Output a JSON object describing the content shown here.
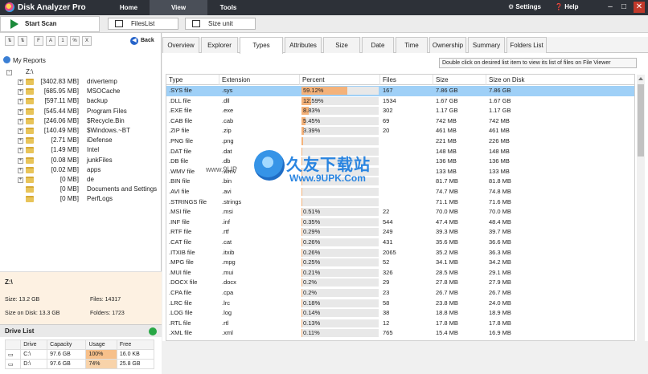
{
  "app": {
    "title": "Disk Analyzer Pro",
    "tabs": [
      "Home",
      "View",
      "Tools"
    ],
    "active_tab": "View",
    "settings": "Settings",
    "help": "Help"
  },
  "toolbar": {
    "start_scan": "Start Scan",
    "fileslist": "FilesList",
    "size_unit": "Size unit"
  },
  "left": {
    "sort_buttons": [
      "⇅",
      "⇅",
      "F",
      "A",
      "1",
      "%",
      "X"
    ],
    "back": "Back",
    "my_reports": "My Reports",
    "root": "Z:\\",
    "tree": [
      {
        "size": "[3402.83 MB]",
        "name": "drivertemp",
        "expand": "+"
      },
      {
        "size": "[685.95 MB]",
        "name": "MSOCache",
        "expand": "+"
      },
      {
        "size": "[597.11 MB]",
        "name": "backup",
        "expand": "+"
      },
      {
        "size": "[545.44 MB]",
        "name": "Program Files",
        "expand": "+"
      },
      {
        "size": "[246.06 MB]",
        "name": "$Recycle.Bin",
        "expand": "+"
      },
      {
        "size": "[140.49 MB]",
        "name": "$Windows.~BT",
        "expand": "+"
      },
      {
        "size": "[2.71 MB]",
        "name": "iDefense",
        "expand": "+"
      },
      {
        "size": "[1.49 MB]",
        "name": "Intel",
        "expand": "+"
      },
      {
        "size": "[0.08 MB]",
        "name": "junkFiles",
        "expand": "+"
      },
      {
        "size": "[0.02 MB]",
        "name": "apps",
        "expand": "+"
      },
      {
        "size": "[0 MB]",
        "name": "de",
        "expand": "+"
      },
      {
        "size": "[0 MB]",
        "name": "Documents and Settings",
        "expand": ""
      },
      {
        "size": "[0 MB]",
        "name": "PerfLogs",
        "expand": ""
      }
    ],
    "info": {
      "drive": "Z:\\",
      "size": "Size: 13.2 GB",
      "files": "Files: 14317",
      "size_on_disk": "Size on Disk: 13.3 GB",
      "folders": "Folders: 1723"
    },
    "drive_list": {
      "title": "Drive List",
      "headers": [
        "",
        "Drive",
        "Capacity",
        "Usage",
        "Free"
      ],
      "rows": [
        {
          "drive": "C:\\",
          "capacity": "97.6 GB",
          "usage": "100%",
          "free": "16.0 KB",
          "usage_pct": 100
        },
        {
          "drive": "D:\\",
          "capacity": "97.6 GB",
          "usage": "74%",
          "free": "25.8 GB",
          "usage_pct": 74
        }
      ]
    }
  },
  "tabs": [
    "Overview",
    "Explorer",
    "Types",
    "Attributes",
    "Size",
    "Date",
    "Time",
    "Ownership",
    "Summary",
    "Folders List"
  ],
  "active_view": "Types",
  "hint": "Double click on desired list item to view its list of files on File Viewer",
  "table": {
    "headers": [
      "Type",
      "Extension",
      "Percent",
      "Files",
      "Size",
      "Size on Disk"
    ],
    "rows": [
      {
        "type": ".SYS file",
        "ext": ".sys",
        "pct": "59.12%",
        "pv": 59.12,
        "files": "167",
        "size": "7.86 GB",
        "disk": "7.86 GB"
      },
      {
        "type": ".DLL file",
        "ext": ".dll",
        "pct": "12.59%",
        "pv": 12.59,
        "files": "1534",
        "size": "1.67 GB",
        "disk": "1.67 GB"
      },
      {
        "type": ".EXE file",
        "ext": ".exe",
        "pct": "8.83%",
        "pv": 8.83,
        "files": "302",
        "size": "1.17 GB",
        "disk": "1.17 GB"
      },
      {
        "type": ".CAB file",
        "ext": ".cab",
        "pct": "5.45%",
        "pv": 5.45,
        "files": "69",
        "size": "742 MB",
        "disk": "742 MB"
      },
      {
        "type": ".ZIP file",
        "ext": ".zip",
        "pct": "3.39%",
        "pv": 3.39,
        "files": "20",
        "size": "461 MB",
        "disk": "461 MB"
      },
      {
        "type": ".PNG file",
        "ext": ".png",
        "pct": "",
        "pv": 1.6,
        "files": "",
        "size": "221 MB",
        "disk": "226 MB"
      },
      {
        "type": ".DAT file",
        "ext": ".dat",
        "pct": "",
        "pv": 1.1,
        "files": "",
        "size": "148 MB",
        "disk": "148 MB"
      },
      {
        "type": ".DB file",
        "ext": ".db",
        "pct": "",
        "pv": 1.0,
        "files": "",
        "size": "136 MB",
        "disk": "136 MB"
      },
      {
        "type": ".WMV file",
        "ext": ".wmv",
        "pct": "",
        "pv": 1.0,
        "files": "",
        "size": "133 MB",
        "disk": "133 MB"
      },
      {
        "type": ".BIN file",
        "ext": ".bin",
        "pct": "",
        "pv": 0.6,
        "files": "",
        "size": "81.7 MB",
        "disk": "81.8 MB"
      },
      {
        "type": ".AVI file",
        "ext": ".avi",
        "pct": "",
        "pv": 0.6,
        "files": "",
        "size": "74.7 MB",
        "disk": "74.8 MB"
      },
      {
        "type": ".STRINGS file",
        "ext": ".strings",
        "pct": "",
        "pv": 0.5,
        "files": "",
        "size": "71.1 MB",
        "disk": "71.6 MB"
      },
      {
        "type": ".MSI file",
        "ext": ".msi",
        "pct": "0.51%",
        "pv": 0.51,
        "files": "22",
        "size": "70.0 MB",
        "disk": "70.0 MB"
      },
      {
        "type": ".INF file",
        "ext": ".inf",
        "pct": "0.35%",
        "pv": 0.35,
        "files": "544",
        "size": "47.4 MB",
        "disk": "48.4 MB"
      },
      {
        "type": ".RTF file",
        "ext": ".rtf",
        "pct": "0.29%",
        "pv": 0.29,
        "files": "249",
        "size": "39.3 MB",
        "disk": "39.7 MB"
      },
      {
        "type": ".CAT file",
        "ext": ".cat",
        "pct": "0.26%",
        "pv": 0.26,
        "files": "431",
        "size": "35.6 MB",
        "disk": "36.6 MB"
      },
      {
        "type": ".ITXIB file",
        "ext": ".itxib",
        "pct": "0.26%",
        "pv": 0.26,
        "files": "2065",
        "size": "35.2 MB",
        "disk": "36.3 MB"
      },
      {
        "type": ".MPG file",
        "ext": ".mpg",
        "pct": "0.25%",
        "pv": 0.25,
        "files": "52",
        "size": "34.1 MB",
        "disk": "34.2 MB"
      },
      {
        "type": ".MUI file",
        "ext": ".mui",
        "pct": "0.21%",
        "pv": 0.21,
        "files": "326",
        "size": "28.5 MB",
        "disk": "29.1 MB"
      },
      {
        "type": ".DOCX file",
        "ext": ".docx",
        "pct": "0.2%",
        "pv": 0.2,
        "files": "29",
        "size": "27.8 MB",
        "disk": "27.9 MB"
      },
      {
        "type": ".CPA file",
        "ext": ".cpa",
        "pct": "0.2%",
        "pv": 0.2,
        "files": "23",
        "size": "26.7 MB",
        "disk": "26.7 MB"
      },
      {
        "type": ".LRC file",
        "ext": ".lrc",
        "pct": "0.18%",
        "pv": 0.18,
        "files": "58",
        "size": "23.8 MB",
        "disk": "24.0 MB"
      },
      {
        "type": ".LOG file",
        "ext": ".log",
        "pct": "0.14%",
        "pv": 0.14,
        "files": "38",
        "size": "18.8 MB",
        "disk": "18.9 MB"
      },
      {
        "type": ".RTL file",
        "ext": ".rtl",
        "pct": "0.13%",
        "pv": 0.13,
        "files": "12",
        "size": "17.8 MB",
        "disk": "17.8 MB"
      },
      {
        "type": ".XML file",
        "ext": ".xml",
        "pct": "0.11%",
        "pv": 0.11,
        "files": "765",
        "size": "15.4 MB",
        "disk": "16.9 MB"
      }
    ]
  },
  "watermark": {
    "text": "久友下载站",
    "url": "Www.9UPK.Com",
    "tag": "www.9UP"
  }
}
